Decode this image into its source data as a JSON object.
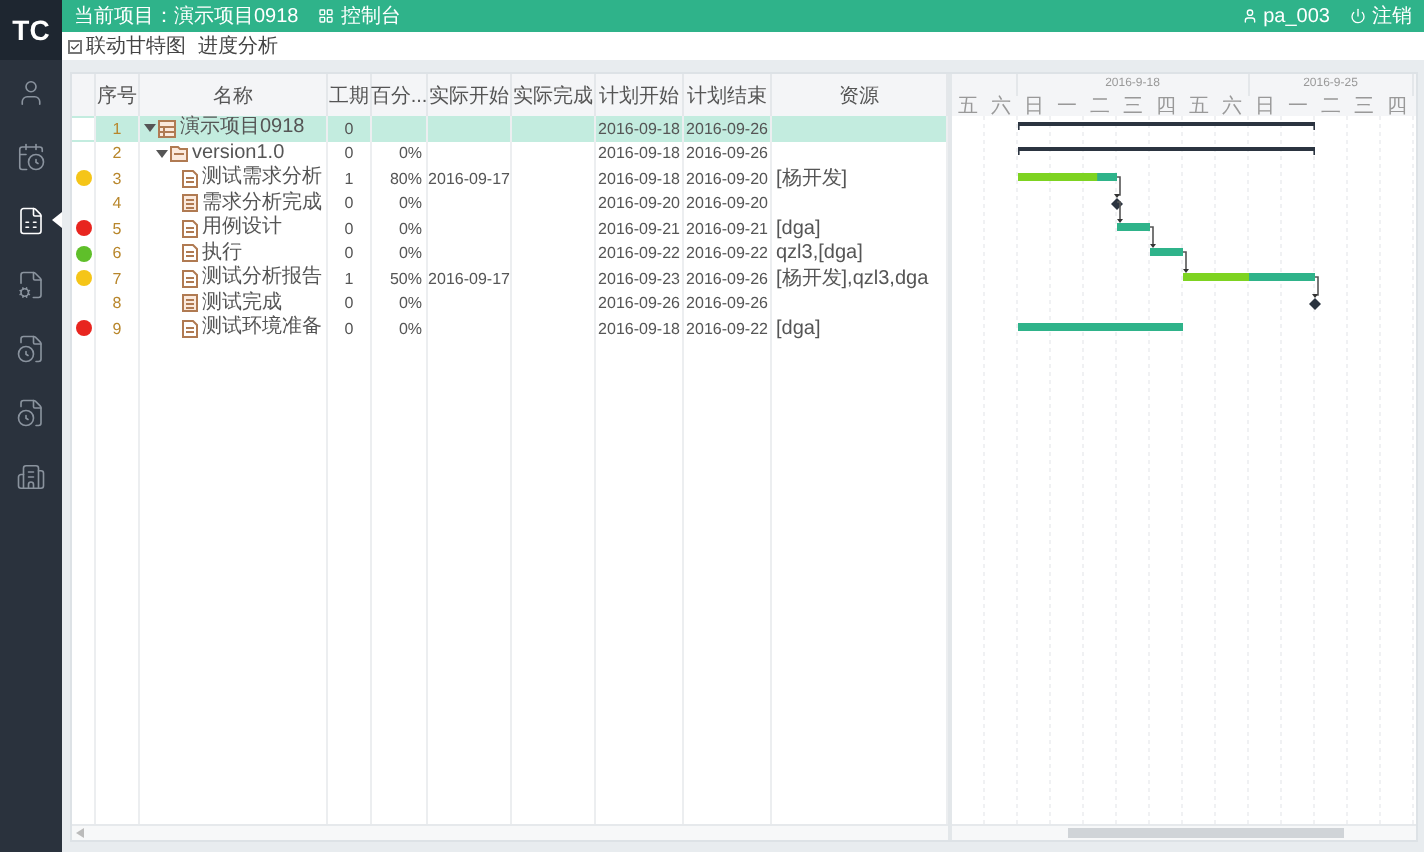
{
  "sidebar": {
    "logo": "TC",
    "items": [
      {
        "selected": false
      },
      {
        "selected": false
      },
      {
        "selected": true
      },
      {
        "selected": false
      },
      {
        "selected": false
      },
      {
        "selected": false
      },
      {
        "selected": false
      }
    ]
  },
  "top_bar": {
    "project": "当前项目：演示项目0918",
    "console": "控制台",
    "user": "pa_003",
    "logout": "注销"
  },
  "toolbar": {
    "link_gantt": {
      "label": "联动甘特图",
      "checked": true
    },
    "progress_analysis": "进度分析"
  },
  "table": {
    "columns": [
      "序号",
      "名称",
      "工期",
      "百分...",
      "实际开始",
      "实际完成",
      "计划开始",
      "计划结束",
      "资源"
    ],
    "rows": [
      {
        "number": "1",
        "name": "演示项目0918",
        "kind": "project",
        "selected": true,
        "expanded": true,
        "duration": "0",
        "plan_start": "2016-09-18",
        "plan_end": "2016-09-26",
        "children": [
          {
            "number": "2",
            "name": "version1.0",
            "kind": "version",
            "selected": false,
            "expanded": true,
            "duration": "0",
            "percent": "0%",
            "plan_start": "2016-09-18",
            "plan_end": "2016-09-26",
            "children": [
              {
                "number": "3",
                "name": "测试需求分析",
                "kind": "task",
                "selected": false,
                "color": "#f5c518",
                "duration": "1",
                "percent": "80%",
                "actual_start": "2016-09-17",
                "plan_start": "2016-09-18",
                "plan_end": "2016-09-20",
                "resource": "[杨开发]",
                "linked": false
              },
              {
                "number": "4",
                "name": "需求分析完成",
                "kind": "milestone",
                "selected": false,
                "duration": "0",
                "percent": "0%",
                "plan_start": "2016-09-20",
                "plan_end": "2016-09-20",
                "linked": true
              },
              {
                "number": "5",
                "name": "用例设计",
                "kind": "task",
                "selected": false,
                "color": "#e8251f",
                "duration": "0",
                "percent": "0%",
                "plan_start": "2016-09-21",
                "plan_end": "2016-09-21",
                "resource": "[dga]",
                "linked": true
              },
              {
                "number": "6",
                "name": "执行",
                "kind": "task",
                "selected": false,
                "color": "#5fbf2a",
                "duration": "0",
                "percent": "0%",
                "plan_start": "2016-09-22",
                "plan_end": "2016-09-22",
                "resource": "qzl3,[dga]",
                "linked": true
              },
              {
                "number": "7",
                "name": "测试分析报告",
                "kind": "task",
                "selected": false,
                "color": "#f5c518",
                "duration": "1",
                "percent": "50%",
                "actual_start": "2016-09-17",
                "plan_start": "2016-09-23",
                "plan_end": "2016-09-26",
                "resource": "[杨开发],qzl3,dga",
                "linked": true
              },
              {
                "number": "8",
                "name": "测试完成",
                "kind": "milestone",
                "selected": false,
                "duration": "0",
                "percent": "0%",
                "plan_start": "2016-09-26",
                "plan_end": "2016-09-26",
                "linked": true
              },
              {
                "number": "9",
                "name": "测试环境准备",
                "kind": "task",
                "selected": false,
                "color": "#e8251f",
                "duration": "0",
                "percent": "0%",
                "plan_start": "2016-09-18",
                "plan_end": "2016-09-22",
                "resource": "[dga]",
                "linked": false
              }
            ]
          }
        ]
      }
    ]
  },
  "timeline": {
    "lead_days": [
      "五",
      "六"
    ],
    "weeks": [
      {
        "label": "2016-9-18",
        "days": [
          "日",
          "一",
          "二",
          "三",
          "四",
          "五",
          "六"
        ]
      },
      {
        "label": "2016-9-25",
        "days": [
          "日",
          "一",
          "二",
          "三",
          "四"
        ]
      }
    ]
  }
}
